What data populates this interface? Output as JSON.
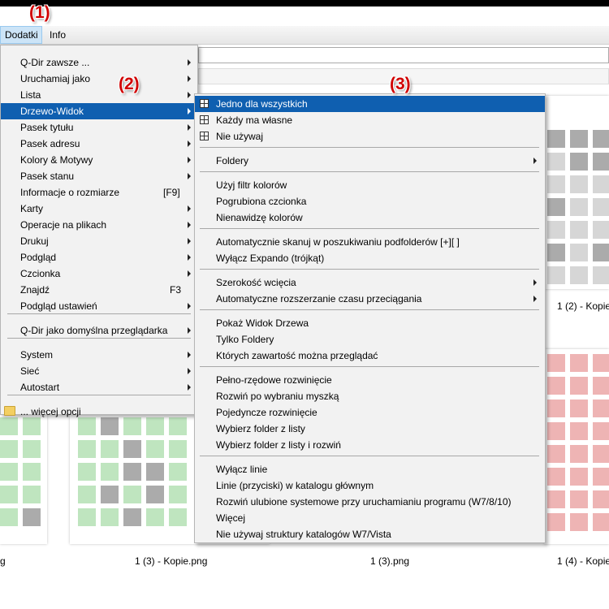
{
  "menubar": {
    "dodatki": "Dodatki",
    "info": "Info"
  },
  "annotations": [
    "(1)",
    "(2)",
    "(3)"
  ],
  "captions": [
    "g",
    "1 (3) - Kopie.png",
    "1 (3).png",
    "1 (4) - Kopie",
    "1 (2) - Kopie"
  ],
  "menu1": {
    "items": [
      "Q-Dir zawsze ...",
      "Uruchamiaj jako",
      "Lista",
      "Drzewo-Widok",
      "Pasek tytułu",
      "Pasek adresu",
      "Kolory & Motywy",
      "Pasek stanu",
      "Informacje o rozmiarze",
      "Karty",
      "Operacje na plikach",
      "Drukuj",
      "Podgląd",
      "Czcionka",
      "Znajdź",
      "Podgląd ustawień",
      "Q-Dir jako domyślna przeglądarka",
      "System",
      "Sieć",
      "Autostart",
      "... więcej opcji"
    ],
    "shortcuts": {
      "size": "[F9]",
      "find": "F3"
    }
  },
  "menu2": {
    "items": [
      "Jedno dla wszystkich",
      "Każdy ma własne",
      "Nie używaj",
      "Foldery",
      "Użyj filtr kolorów",
      "Pogrubiona czcionka",
      "Nienawidzę kolorów",
      "Automatycznie skanuj w poszukiwaniu podfolderów [+][ ]",
      "Wyłącz Expando (trójkąt)",
      "Szerokość wcięcia",
      "Automatyczne rozszerzanie czasu przeciągania",
      "Pokaż Widok Drzewa",
      "Tylko Foldery",
      "Których zawartość można przeglądać",
      "Pełno-rzędowe rozwinięcie",
      "Rozwiń po wybraniu myszką",
      "Pojedyncze rozwinięcie",
      "Wybierz folder z listy",
      "Wybierz folder z listy i rozwiń",
      "Wyłącz linie",
      "Linie (przyciski) w katalogu głównym",
      "Rozwiń ulubione systemowe przy uruchamianiu programu (W7/8/10)",
      "Więcej",
      "Nie używaj struktury katalogów W7/Vista"
    ]
  },
  "colors": {
    "highlight": "#0f5fb0",
    "annotation": "#d00000",
    "green_tile": "#bfe5bf",
    "red_tile": "#eeb4b4",
    "grey_tile": "#d6d6d6",
    "dark_tile": "#ababab"
  }
}
